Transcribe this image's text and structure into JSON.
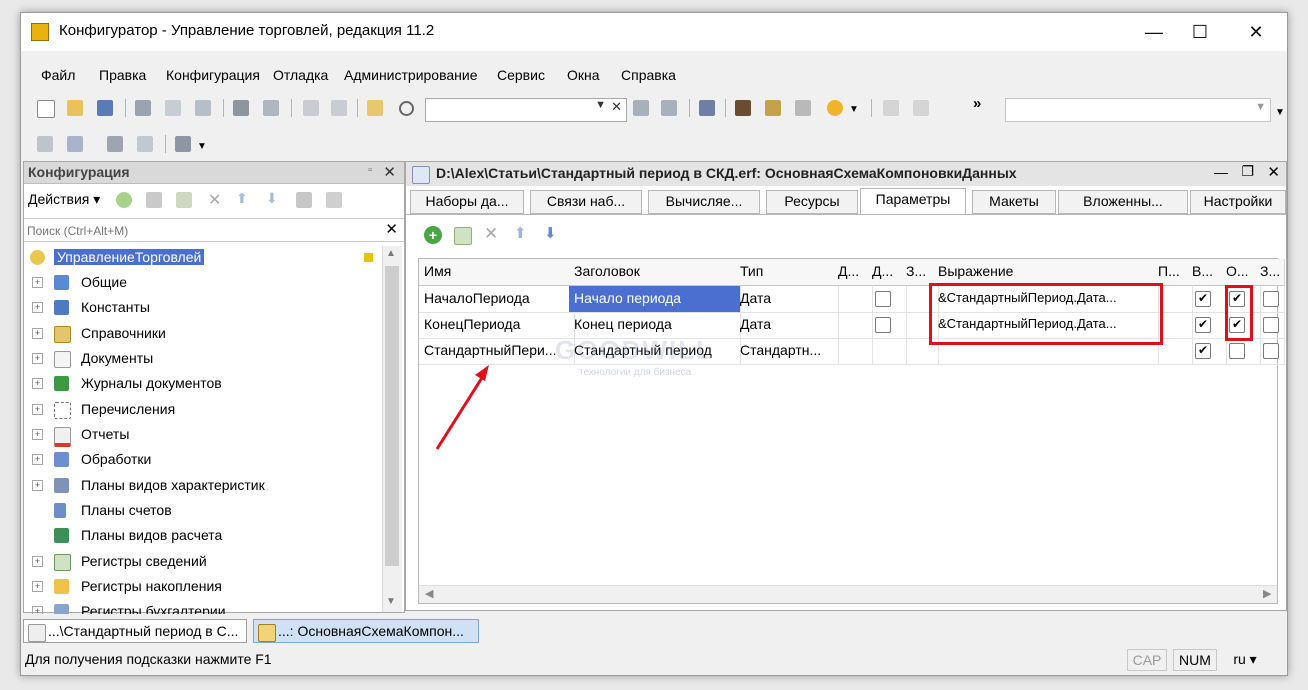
{
  "window": {
    "title": "Конфигуратор - Управление торговлей, редакция 11.2",
    "controls": {
      "minimize": "—",
      "maximize": "☐",
      "close": "✕"
    }
  },
  "menu": [
    "Файл",
    "Правка",
    "Конфигурация",
    "Отладка",
    "Администрирование",
    "Сервис",
    "Окна",
    "Справка"
  ],
  "toolbar": {
    "overflow": "»"
  },
  "config_panel": {
    "title": "Конфигурация",
    "actions_label": "Действия",
    "search_placeholder": "Поиск (Ctrl+Alt+M)",
    "tree": [
      {
        "label": "УправлениеТорговлей",
        "icon": "root-config-icon",
        "selected": true
      },
      {
        "label": "Общие",
        "icon": "common-icon",
        "expand": "+"
      },
      {
        "label": "Константы",
        "icon": "constants-icon",
        "expand": "+"
      },
      {
        "label": "Справочники",
        "icon": "catalogs-icon",
        "expand": "+"
      },
      {
        "label": "Документы",
        "icon": "documents-icon",
        "expand": "+"
      },
      {
        "label": "Журналы документов",
        "icon": "journals-icon",
        "expand": "+"
      },
      {
        "label": "Перечисления",
        "icon": "enums-icon",
        "expand": "+"
      },
      {
        "label": "Отчеты",
        "icon": "reports-icon",
        "expand": "+"
      },
      {
        "label": "Обработки",
        "icon": "processing-icon",
        "expand": "+"
      },
      {
        "label": "Планы видов характеристик",
        "icon": "char-types-icon",
        "expand": "+"
      },
      {
        "label": "Планы счетов",
        "icon": "chart-of-accounts-icon",
        "expand": ""
      },
      {
        "label": "Планы видов расчета",
        "icon": "calc-types-icon",
        "expand": ""
      },
      {
        "label": "Регистры сведений",
        "icon": "info-registers-icon",
        "expand": "+"
      },
      {
        "label": "Регистры накопления",
        "icon": "accum-registers-icon",
        "expand": "+"
      },
      {
        "label": "Регистры бухгалтерии",
        "icon": "accounting-registers-icon",
        "expand": "+"
      }
    ]
  },
  "editor": {
    "title": "D:\\Alex\\Статьи\\Стандартный период в СКД.erf: ОсновнаяСхемаКомпоновкиДанных",
    "tabs": [
      "Наборы да...",
      "Связи наб...",
      "Вычисляе...",
      "Ресурсы",
      "Параметры",
      "Макеты",
      "Вложенны...",
      "Настройки"
    ],
    "active_tab": "Параметры",
    "columns": [
      "Имя",
      "Заголовок",
      "Тип",
      "Д...",
      "Д...",
      "З...",
      "Выражение",
      "П...",
      "В...",
      "О...",
      "З..."
    ],
    "rows": [
      {
        "name": "НачалоПериода",
        "caption": "Начало периода",
        "type": "Дата",
        "expression": "&СтандартныйПериод.Дата...",
        "d2": false,
        "v": true,
        "o": true,
        "z": false
      },
      {
        "name": "КонецПериода",
        "caption": "Конец периода",
        "type": "Дата",
        "expression": "&СтандартныйПериод.Дата...",
        "d2": false,
        "v": true,
        "o": true,
        "z": false
      },
      {
        "name": "СтандартныйПери...",
        "caption": "Стандартный период",
        "type": "Стандартн...",
        "expression": "",
        "d2": null,
        "v": true,
        "o": false,
        "z": false
      }
    ]
  },
  "watermark": {
    "brand": "GOODWILL",
    "tagline": "технологии для бизнеса"
  },
  "taskbar": [
    "...\\Стандартный период в С...",
    "...: ОсновнаяСхемаКомпон..."
  ],
  "status": {
    "hint": "Для получения подсказки нажмите F1",
    "cap": "CAP",
    "num": "NUM",
    "lang": "ru"
  },
  "accent": {
    "selection": "#4a6fd0",
    "highlight": "#e0101a"
  }
}
